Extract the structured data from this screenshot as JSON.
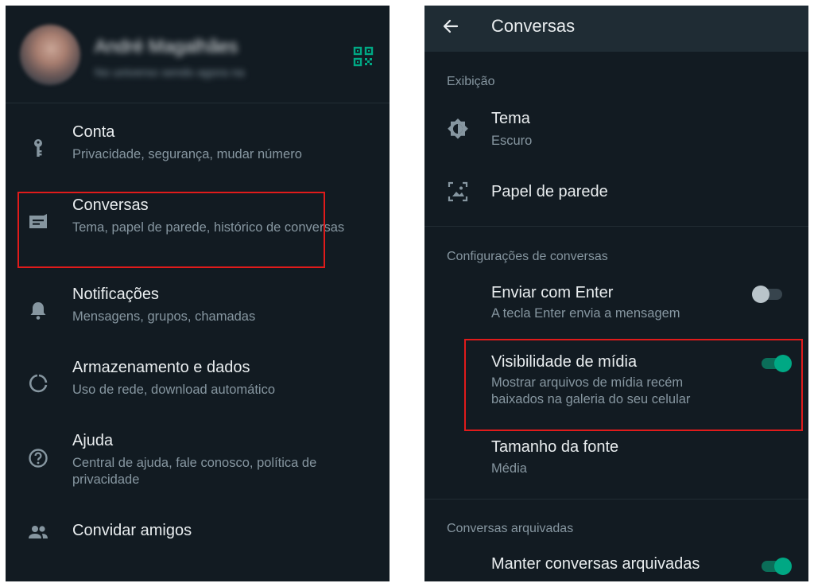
{
  "colors": {
    "panel_bg": "#121b22",
    "appbar_bg": "#1f2c34",
    "accent": "#00a884",
    "highlight": "#e01b1b"
  },
  "left": {
    "profile": {
      "name": "André Magalhães",
      "status": "No universo sendo agora na",
      "qr_icon": "qr-code-icon"
    },
    "menu": [
      {
        "icon": "key-icon",
        "title": "Conta",
        "subtitle": "Privacidade, segurança, mudar número"
      },
      {
        "icon": "chat-icon",
        "title": "Conversas",
        "subtitle": "Tema, papel de parede, histórico de conversas"
      },
      {
        "icon": "bell-icon",
        "title": "Notificações",
        "subtitle": "Mensagens, grupos, chamadas"
      },
      {
        "icon": "data-usage-icon",
        "title": "Armazenamento e dados",
        "subtitle": "Uso de rede, download automático"
      },
      {
        "icon": "help-icon",
        "title": "Ajuda",
        "subtitle": "Central de ajuda, fale conosco, política de privacidade"
      },
      {
        "icon": "people-icon",
        "title": "Convidar amigos"
      }
    ]
  },
  "right": {
    "appbar": {
      "title": "Conversas",
      "back_icon": "arrow-back-icon"
    },
    "sections": [
      {
        "header": "Exibição"
      },
      {
        "header": "Configurações de conversas"
      },
      {
        "header": "Conversas arquivadas"
      }
    ],
    "display": {
      "theme": {
        "icon": "brightness-icon",
        "title": "Tema",
        "value": "Escuro"
      },
      "wallpaper": {
        "icon": "wallpaper-icon",
        "title": "Papel de parede"
      }
    },
    "chat_settings": {
      "enter_send": {
        "title": "Enviar com Enter",
        "subtitle": "A tecla Enter envia a mensagem",
        "enabled": false
      },
      "media_visibility": {
        "title": "Visibilidade de mídia",
        "subtitle": "Mostrar arquivos de mídia recém baixados na galeria do seu celular",
        "enabled": true
      },
      "font_size": {
        "title": "Tamanho da fonte",
        "value": "Média"
      }
    },
    "archived": {
      "keep_archived": {
        "title": "Manter conversas arquivadas",
        "enabled": true
      }
    }
  }
}
